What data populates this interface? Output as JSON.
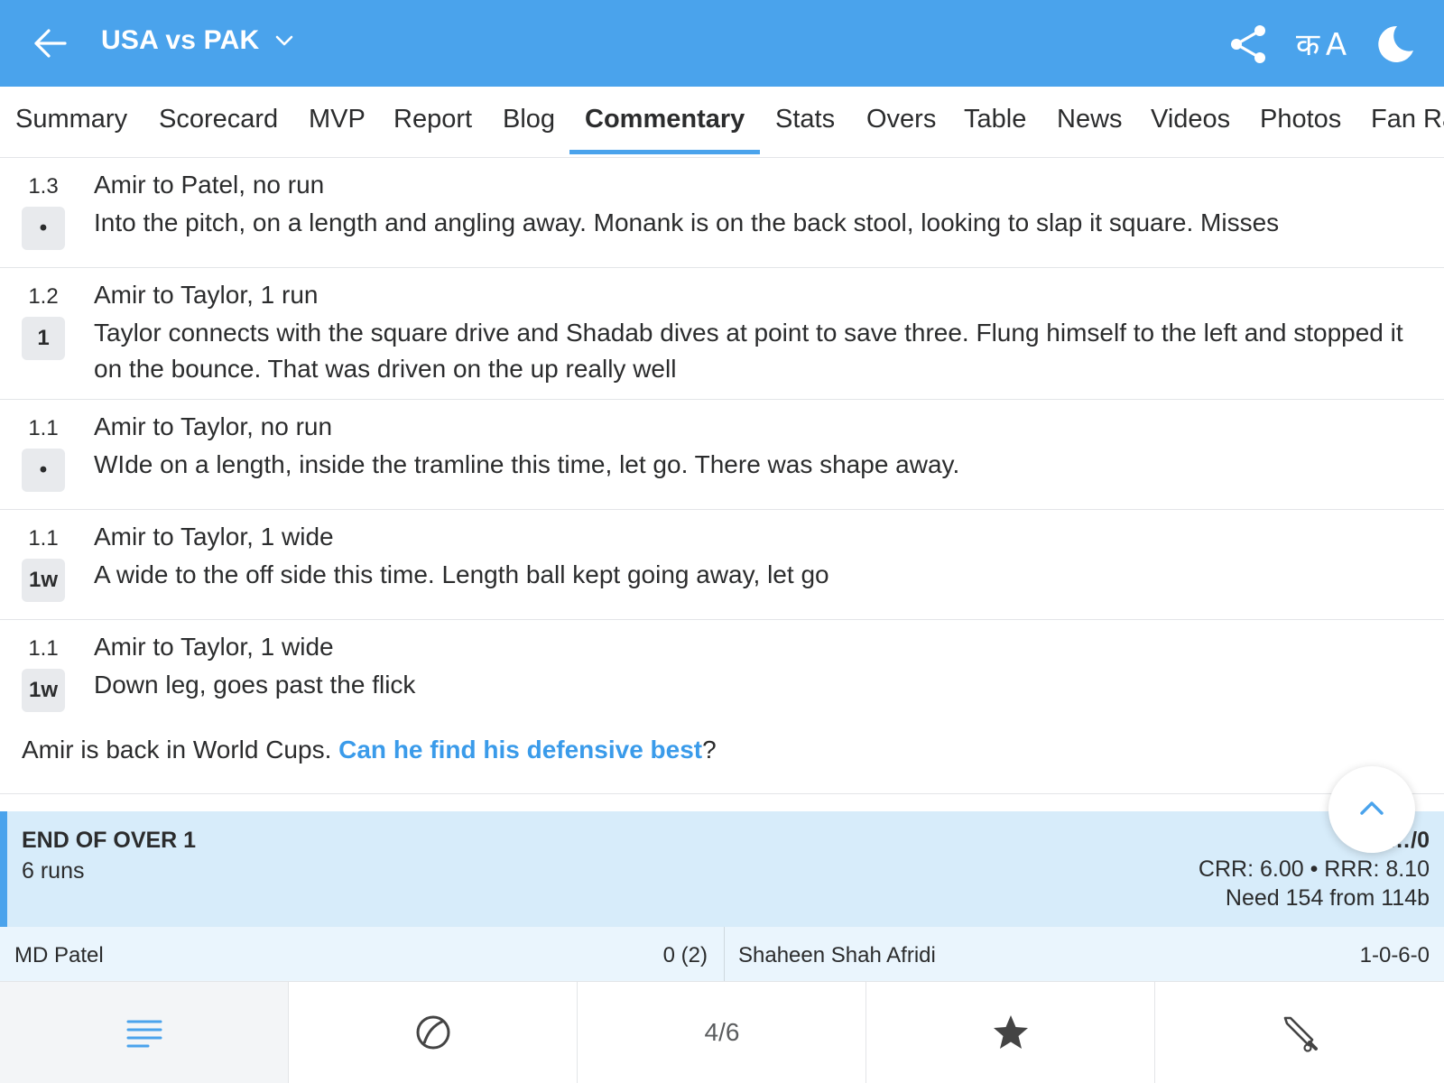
{
  "header": {
    "title": "USA vs PAK",
    "lang_label": "क A",
    "accent": "#4aa3ec"
  },
  "tabs": [
    {
      "label": "Summary"
    },
    {
      "label": "Scorecard"
    },
    {
      "label": "MVP"
    },
    {
      "label": "Report"
    },
    {
      "label": "Blog"
    },
    {
      "label": "Commentary",
      "active": true
    },
    {
      "label": "Stats"
    },
    {
      "label": "Overs"
    },
    {
      "label": "Table"
    },
    {
      "label": "News"
    },
    {
      "label": "Videos"
    },
    {
      "label": "Photos"
    },
    {
      "label": "Fan Ra"
    }
  ],
  "commentary": [
    {
      "over": "1.3",
      "badge": "•",
      "head": "Amir to Patel, no run",
      "desc": "Into the pitch, on a length and angling away. Monank is on the back stool, looking to slap it square. Misses"
    },
    {
      "over": "1.2",
      "badge": "1",
      "head": "Amir to Taylor, 1 run",
      "desc": "Taylor connects with the square drive and Shadab dives at point to save three. Flung himself to the left and stopped it on the bounce. That was driven on the up really well"
    },
    {
      "over": "1.1",
      "badge": "•",
      "head": "Amir to Taylor, no run",
      "desc": "WIde on a length, inside the tramline this time, let go. There was shape away."
    },
    {
      "over": "1.1",
      "badge": "1w",
      "head": "Amir to Taylor, 1 wide",
      "desc": "A wide to the off side this time. Length ball kept going away, let go"
    },
    {
      "over": "1.1",
      "badge": "1w",
      "head": "Amir to Taylor, 1 wide",
      "desc": "Down leg, goes past the flick"
    }
  ],
  "note": {
    "prefix": "Amir is back in World Cups. ",
    "link": "Can he find his defensive best",
    "suffix": "?"
  },
  "end_of_over": {
    "title": "END OF OVER 1",
    "runs": "6 runs",
    "score": "U…/0",
    "rates": "CRR: 6.00 • RRR: 8.10",
    "need": "Need 154 from 114b"
  },
  "players": {
    "batter_name": "MD Patel",
    "batter_score": "0 (2)",
    "bowler_name": "Shaheen Shah Afridi",
    "bowler_figures": "1-0-6-0"
  },
  "bottom_nav": {
    "page": "4/6"
  }
}
